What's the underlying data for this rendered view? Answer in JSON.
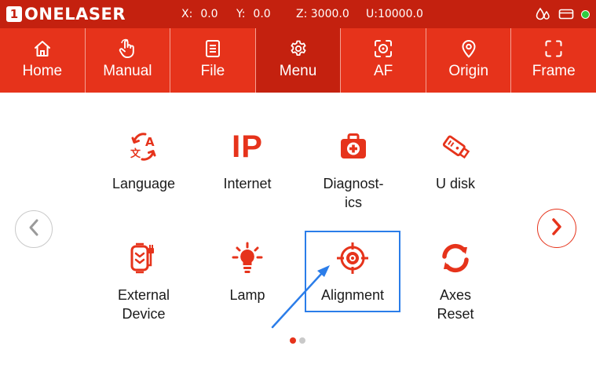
{
  "status_bar": {
    "logo_badge": "1",
    "logo_text": "ONELASER",
    "x_label": "X:",
    "x_value": "0.0",
    "y_label": "Y:",
    "y_value": "0.0",
    "z_text": "Z: 3000.0",
    "u_text": "U:10000.0",
    "icons": [
      "water-drop-icon",
      "card-icon",
      "online-status-dot"
    ],
    "online_color": "#2ecc40"
  },
  "nav": {
    "items": [
      {
        "label": "Home",
        "icon": "home-icon"
      },
      {
        "label": "Manual",
        "icon": "hand-pointer-icon"
      },
      {
        "label": "File",
        "icon": "document-icon"
      },
      {
        "label": "Menu",
        "icon": "gear-icon",
        "active": true
      },
      {
        "label": "AF",
        "icon": "focus-target-icon"
      },
      {
        "label": "Origin",
        "icon": "location-pin-icon"
      },
      {
        "label": "Frame",
        "icon": "frame-icon"
      }
    ]
  },
  "menu": {
    "tiles": [
      {
        "label": "Language",
        "icon": "language-translate-icon"
      },
      {
        "label": "Internet",
        "icon": "ip-icon",
        "icon_text": "IP"
      },
      {
        "label": "Diagnost-\nics",
        "icon": "first-aid-kit-icon"
      },
      {
        "label": "U disk",
        "icon": "usb-drive-icon"
      },
      {
        "label": "External\nDevice",
        "icon": "external-device-icon"
      },
      {
        "label": "Lamp",
        "icon": "light-bulb-icon"
      },
      {
        "label": "Alignment",
        "icon": "crosshair-target-icon",
        "selected": true
      },
      {
        "label": "Axes\nReset",
        "icon": "reset-arrows-icon"
      }
    ],
    "page_current": 1,
    "page_count": 2
  },
  "colors": {
    "brand_red": "#e6331b",
    "dark_red": "#c4210f",
    "selection_blue": "#2b7de9"
  }
}
